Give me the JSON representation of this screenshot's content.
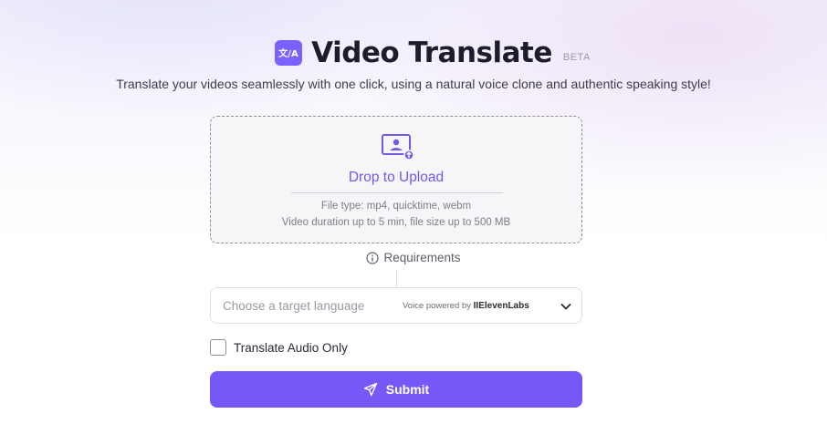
{
  "header": {
    "logo_icon": "translate-icon",
    "logo_text": "文/A",
    "title": "Video Translate",
    "badge": "BETA",
    "subtitle": "Translate your videos seamlessly with one click, using a natural voice clone and authentic speaking style!"
  },
  "upload": {
    "icon": "upload-video-icon",
    "label": "Drop to Upload",
    "file_types": "File type: mp4, quicktime, webm",
    "limits": "Video duration up to 5 min, file size up to 500 MB"
  },
  "requirements": {
    "icon": "info-icon",
    "label": "Requirements"
  },
  "language_select": {
    "placeholder": "Choose a target language",
    "powered_prefix": "Voice powered by",
    "powered_brand": "IIElevenLabs",
    "icon": "chevron-down-icon"
  },
  "audio_only": {
    "label": "Translate Audio Only",
    "checked": false
  },
  "submit": {
    "icon": "send-icon",
    "label": "Submit"
  },
  "colors": {
    "accent": "#7658f8",
    "accent_text": "#6e5ae6"
  }
}
